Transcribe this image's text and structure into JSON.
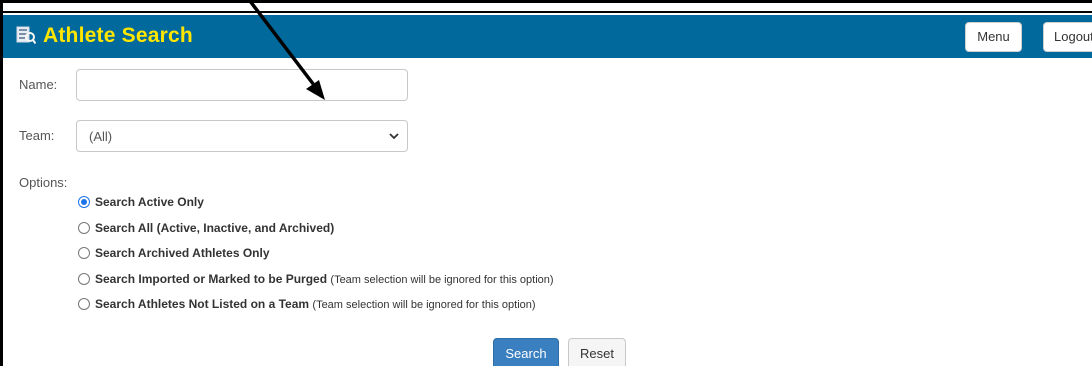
{
  "header": {
    "title": "Athlete Search",
    "menu_label": "Menu",
    "logout_label": "Logout",
    "background_color": "#01699b",
    "title_color": "#ffe600"
  },
  "form": {
    "name_label": "Name:",
    "name_value": "",
    "team_label": "Team:",
    "team_selected": "(All)",
    "options_label": "Options:"
  },
  "options": [
    {
      "label": "Search Active Only",
      "note": "",
      "checked": true
    },
    {
      "label": "Search All (Active, Inactive, and Archived)",
      "note": "",
      "checked": false
    },
    {
      "label": "Search Archived Athletes Only",
      "note": "",
      "checked": false
    },
    {
      "label": "Search Imported or Marked to be Purged",
      "note": "(Team selection will be ignored for this option)",
      "checked": false
    },
    {
      "label": "Search Athletes Not Listed on a Team",
      "note": "(Team selection will be ignored for this option)",
      "checked": false
    }
  ],
  "actions": {
    "search_label": "Search",
    "reset_label": "Reset",
    "search_color": "#3a7fc0"
  },
  "icons": {
    "app": "athlete-search-icon",
    "select": "chevron-down-icon",
    "annotation": "arrow-icon"
  }
}
